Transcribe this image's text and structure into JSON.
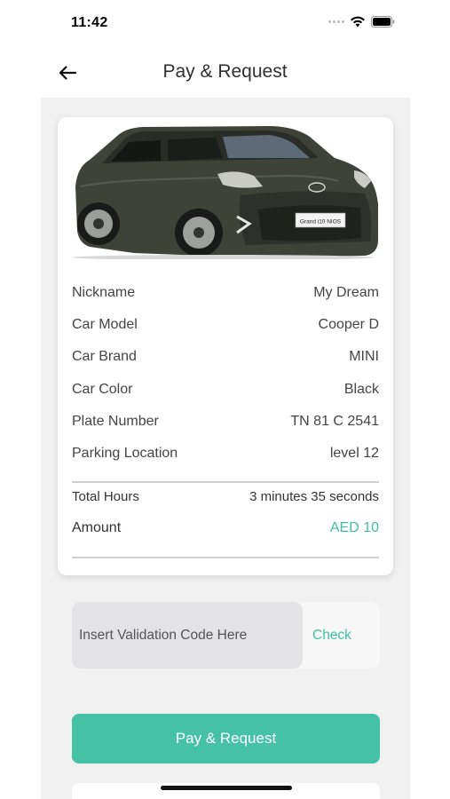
{
  "status_bar": {
    "time": "11:42",
    "icons": [
      "signal-dots-icon",
      "wifi-icon",
      "battery-icon"
    ]
  },
  "header": {
    "back_icon": "arrow-left-icon",
    "title": "Pay & Request"
  },
  "car": {
    "image": "car-photo",
    "details": [
      {
        "label": "Nickname",
        "value": "My Dream"
      },
      {
        "label": "Car Model",
        "value": "Cooper D"
      },
      {
        "label": "Car Brand",
        "value": "MINI"
      },
      {
        "label": "Car Color",
        "value": "Black"
      },
      {
        "label": "Plate Number",
        "value": "TN 81 C 2541"
      },
      {
        "label": "Parking Location",
        "value": "level 12"
      }
    ],
    "plate_text": "Grand i10 NIOS"
  },
  "summary": {
    "hours_label": "Total Hours",
    "hours_value": "3 minutes 35 seconds",
    "amount_label": "Amount",
    "amount_value": "AED 10"
  },
  "validation": {
    "placeholder": "Insert Validation Code Here",
    "value": "",
    "check_label": "Check"
  },
  "actions": {
    "pay_label": "Pay & Request"
  },
  "colors": {
    "accent": "#45c2a6",
    "amount_text": "#3fbfa1",
    "background": "#f1f1f1"
  }
}
